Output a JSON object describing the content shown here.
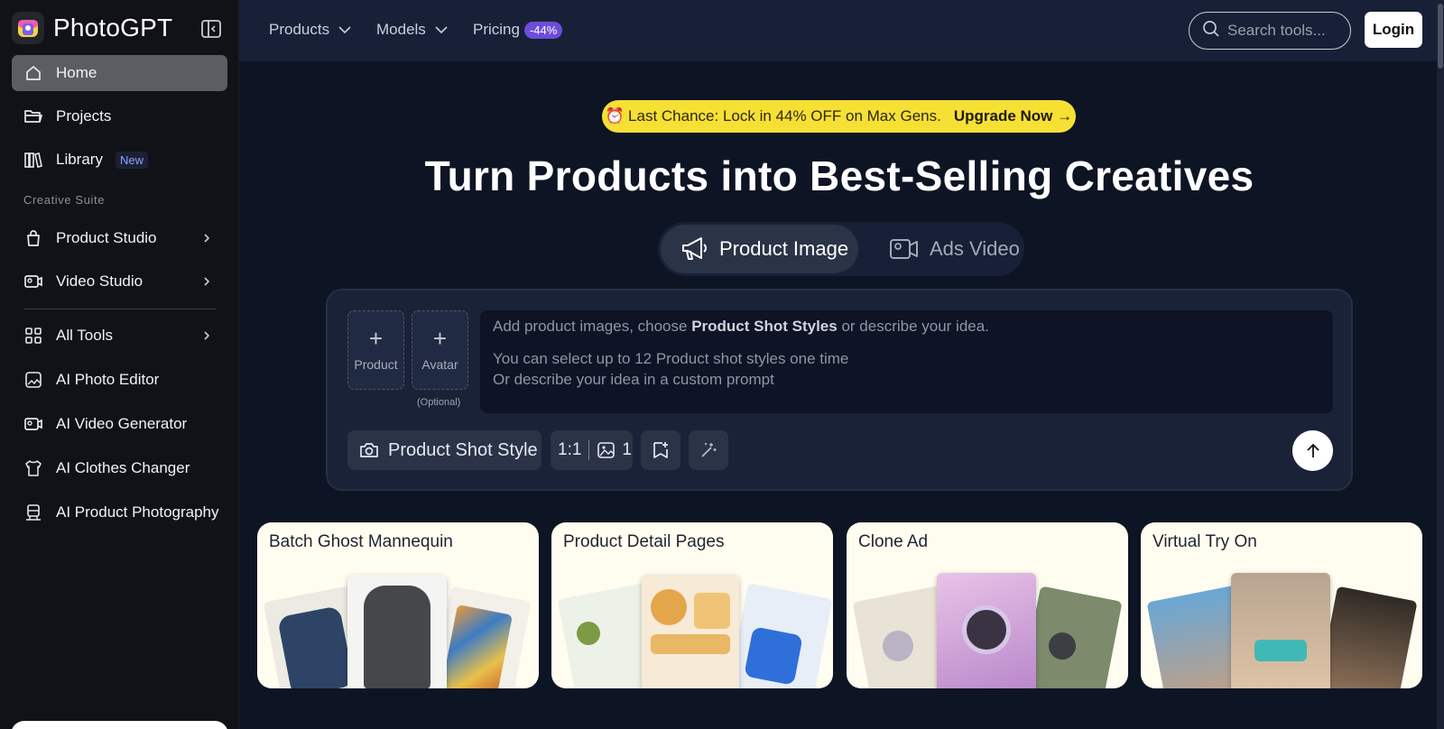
{
  "brand": {
    "name": "PhotoGPT"
  },
  "sidebar": {
    "items": [
      {
        "label": "Home"
      },
      {
        "label": "Projects"
      },
      {
        "label": "Library",
        "badge": "New"
      }
    ],
    "section_label": "Creative Suite",
    "suite": [
      {
        "label": "Product Studio"
      },
      {
        "label": "Video Studio"
      }
    ],
    "tools": [
      {
        "label": "All Tools"
      },
      {
        "label": "AI Photo Editor"
      },
      {
        "label": "AI Video Generator"
      },
      {
        "label": "AI Clothes Changer"
      },
      {
        "label": "AI Product Photography"
      }
    ]
  },
  "topbar": {
    "nav": [
      {
        "label": "Products"
      },
      {
        "label": "Models"
      },
      {
        "label": "Pricing",
        "badge": "-44%"
      }
    ],
    "search_placeholder": "Search tools...",
    "login_label": "Login"
  },
  "promo": {
    "icon": "⏰",
    "text": "Last Chance: Lock in 44% OFF on Max Gens.",
    "cta": "Upgrade Now →"
  },
  "headline": "Turn Products into Best-Selling Creatives",
  "tabs": [
    {
      "label": "Product Image",
      "icon": "megaphone-icon"
    },
    {
      "label": "Ads Video",
      "icon": "video-icon"
    }
  ],
  "composer": {
    "upload_product": "Product",
    "upload_avatar": "Avatar",
    "optional": "(Optional)",
    "prompt_pre": "Add product images, choose ",
    "prompt_highlight": "Product Shot Styles",
    "prompt_post": " or describe your idea.",
    "hint1": "You can select up to 12 Product shot styles one time",
    "hint2": "Or describe your idea in a custom prompt",
    "style_button": "Product Shot Style",
    "ratio": "1:1",
    "count": "1"
  },
  "cards": [
    {
      "title": "Batch Ghost Mannequin"
    },
    {
      "title": "Product Detail Pages"
    },
    {
      "title": "Clone Ad"
    },
    {
      "title": "Virtual Try On"
    }
  ],
  "colors": {
    "accent": "#6d4cd9",
    "promo": "#f6e033",
    "card": "#fffdf0"
  }
}
